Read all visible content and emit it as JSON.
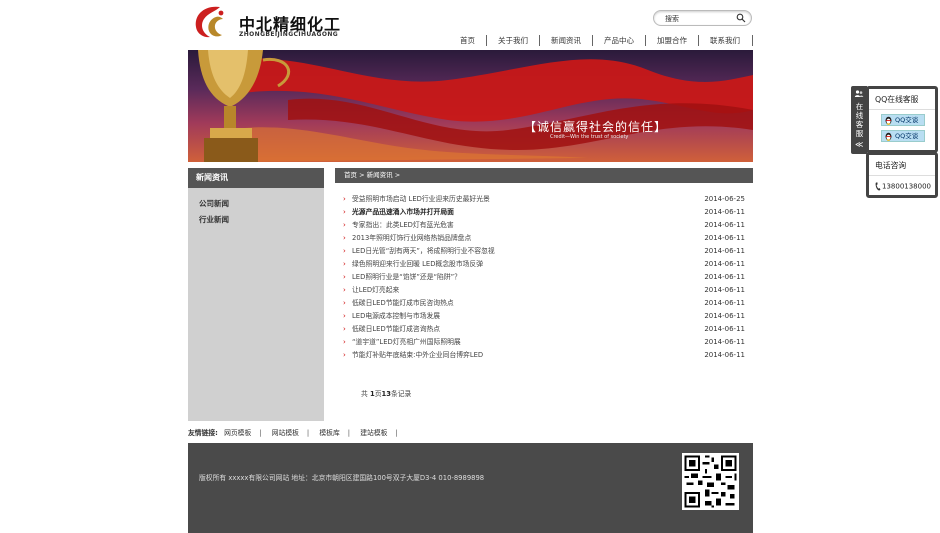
{
  "header": {
    "logo_text": "中北精细化工",
    "logo_sub": "ZHONGBEIJINGCIHUAGONG",
    "search_label": "搜索"
  },
  "nav": [
    "首页",
    "关于我们",
    "新闻资讯",
    "产品中心",
    "加盟合作",
    "联系我们"
  ],
  "banner": {
    "title": "【诚信赢得社会的信任】",
    "subtitle": "Credit—Win the trust of society"
  },
  "sidebar": {
    "title": "新闻资讯",
    "items": [
      "公司新闻",
      "行业新闻"
    ]
  },
  "breadcrumb": {
    "home": "首页",
    "sep": ">",
    "current": "新闻资讯",
    "tail": ">"
  },
  "news": [
    {
      "title": "受益照明市场启动 LED行业迎来历史最好光景",
      "date": "2014-06-25"
    },
    {
      "title": "光源产品迅速涌入市场并打开局面",
      "date": "2014-06-11"
    },
    {
      "title": "专家指出：此类LED灯有蓝光危害",
      "date": "2014-06-11"
    },
    {
      "title": "2013年照明灯饰行业网络热销品牌盘点",
      "date": "2014-06-11"
    },
    {
      "title": "LED日光管“刮有两天”，将成照明行业不容忽视",
      "date": "2014-06-11"
    },
    {
      "title": "绿色照明迎来行业回暖 LED概念股市场反弹",
      "date": "2014-06-11"
    },
    {
      "title": "LED照明行业是“馅饼”还是“陷阱”？",
      "date": "2014-06-11"
    },
    {
      "title": "让LED灯亮起来",
      "date": "2014-06-11"
    },
    {
      "title": "低碳日LED节能灯成市民咨询热点",
      "date": "2014-06-11"
    },
    {
      "title": "LED电源成本控制与市场发展",
      "date": "2014-06-11"
    },
    {
      "title": "低碳日LED节能灯成咨询热点",
      "date": "2014-06-11"
    },
    {
      "title": "“道宇道”LED灯亮相广州国际照明展",
      "date": "2014-06-11"
    },
    {
      "title": "节能灯补贴年底结束:中外企业同台博弈LED",
      "date": "2014-06-11"
    }
  ],
  "pager": {
    "prefix": "共",
    "page": "1",
    "mid": "页",
    "count": "13",
    "suffix": "条记录"
  },
  "links": {
    "label": "友情链接:",
    "items": [
      "网页模板",
      "网站模板",
      "模板库",
      "建站模板"
    ],
    "sep": "|"
  },
  "footer": {
    "copyright": "版权所有 xxxxx有限公司网站 地址：北京市朝阳区建国路100号双子大厦D3-4 010-8989898"
  },
  "float": {
    "tab_text": [
      "在",
      "线",
      "客",
      "服"
    ],
    "tab_arrow": "≪",
    "qq_title": "QQ在线客服",
    "qq_buttons": [
      "QQ交谈",
      "QQ交谈"
    ],
    "phone_title": "电话咨询",
    "phone_number": "13800138000"
  },
  "colors": {
    "header_bar": "#555555",
    "sidebar_bg": "#d0d0d0",
    "footer_bg": "#4a4a4a",
    "bullet": "#cc0000",
    "logo_red": "#cc1f1f",
    "logo_gold": "#b8882a"
  }
}
